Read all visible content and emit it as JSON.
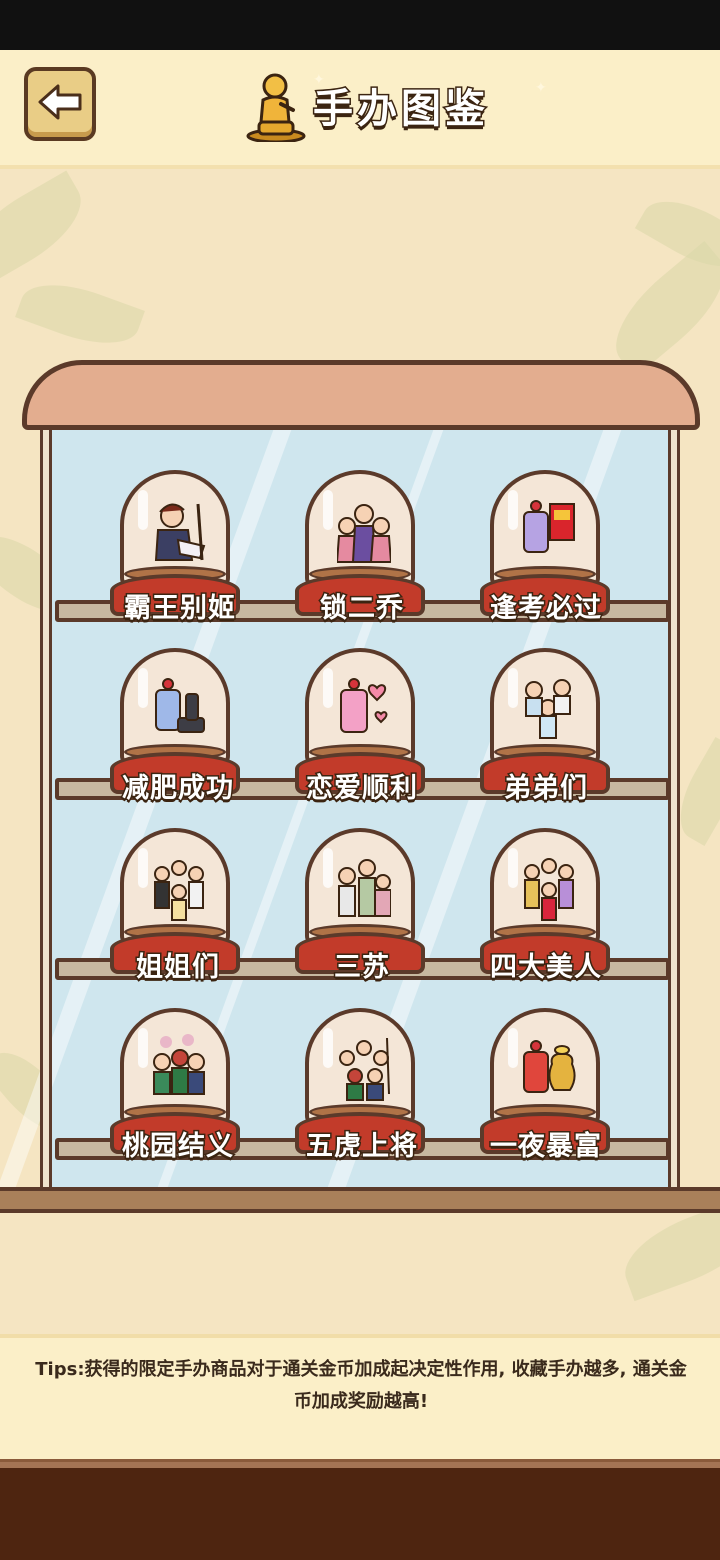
{
  "header": {
    "title": "手办图鉴",
    "back_icon": "arrow-left-icon",
    "trophy_icon": "golden-figure-icon"
  },
  "colors": {
    "header_bg": "#fbefc8",
    "cabinet_frame": "#5b3a2a",
    "pedestal": "#c23b2a",
    "glass": "#cfe6ee",
    "bottom_bar": "#4e2510"
  },
  "figures": [
    {
      "label": "霸王别姬",
      "icon": "warrior-couple-figure"
    },
    {
      "label": "锁二乔",
      "icon": "three-characters-figure"
    },
    {
      "label": "逢考必过",
      "icon": "charm-and-book-figure"
    },
    {
      "label": "减肥成功",
      "icon": "charm-and-dumbbell-figure"
    },
    {
      "label": "恋爱顺利",
      "icon": "love-charm-figure"
    },
    {
      "label": "弟弟们",
      "icon": "boy-group-figure"
    },
    {
      "label": "姐姐们",
      "icon": "girl-group-figure"
    },
    {
      "label": "三苏",
      "icon": "three-scholars-figure"
    },
    {
      "label": "四大美人",
      "icon": "four-beauties-figure"
    },
    {
      "label": "桃园结义",
      "icon": "peach-garden-oath-figure"
    },
    {
      "label": "五虎上将",
      "icon": "five-tiger-generals-figure"
    },
    {
      "label": "一夜暴富",
      "icon": "charm-and-money-bag-figure"
    }
  ],
  "tips": {
    "text": "Tips:获得的限定手办商品对于通关金币加成起决定性作用, 收藏手办越多, 通关金币加成奖励越高!"
  }
}
